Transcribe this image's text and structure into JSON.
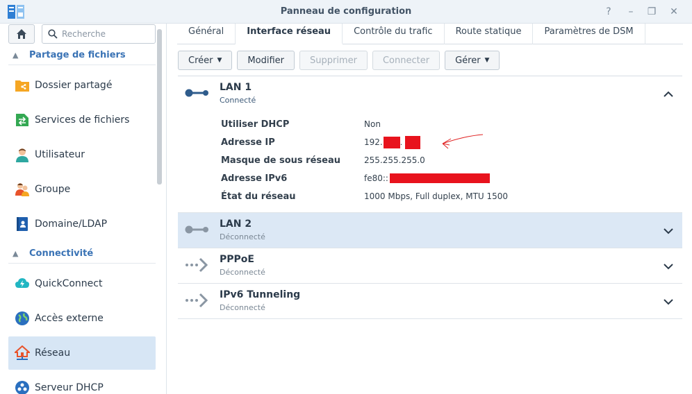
{
  "window": {
    "title": "Panneau de configuration",
    "help_glyph": "?",
    "minimize_glyph": "–",
    "maximize_glyph": "❐",
    "close_glyph": "✕"
  },
  "sidebar": {
    "search_placeholder": "Recherche",
    "sections": [
      {
        "label": "Partage de fichiers",
        "items": [
          {
            "label": "Dossier partagé",
            "icon": "shared-folder-icon"
          },
          {
            "label": "Services de fichiers",
            "icon": "file-services-icon"
          },
          {
            "label": "Utilisateur",
            "icon": "user-icon"
          },
          {
            "label": "Groupe",
            "icon": "group-icon"
          },
          {
            "label": "Domaine/LDAP",
            "icon": "domain-ldap-icon"
          }
        ]
      },
      {
        "label": "Connectivité",
        "items": [
          {
            "label": "QuickConnect",
            "icon": "quickconnect-icon"
          },
          {
            "label": "Accès externe",
            "icon": "external-access-icon"
          },
          {
            "label": "Réseau",
            "icon": "network-icon",
            "active": true
          },
          {
            "label": "Serveur DHCP",
            "icon": "dhcp-server-icon"
          }
        ]
      }
    ]
  },
  "tabs": [
    {
      "label": "Général"
    },
    {
      "label": "Interface réseau",
      "active": true
    },
    {
      "label": "Contrôle du trafic"
    },
    {
      "label": "Route statique"
    },
    {
      "label": "Paramètres de DSM"
    }
  ],
  "toolbar": {
    "create": "Créer",
    "modify": "Modifier",
    "delete": "Supprimer",
    "connect": "Connecter",
    "manage": "Gérer"
  },
  "interfaces": [
    {
      "name": "LAN 1",
      "status": "Connecté",
      "expanded": true,
      "details": {
        "dhcp_label": "Utiliser DHCP",
        "dhcp_value": "Non",
        "ip_label": "Adresse IP",
        "ip_value": "192.",
        "mask_label": "Masque de sous réseau",
        "mask_value": "255.255.255.0",
        "ipv6_label": "Adresse IPv6",
        "ipv6_value": "fe80::",
        "state_label": "État du réseau",
        "state_value": "1000 Mbps, Full duplex, MTU 1500"
      }
    },
    {
      "name": "LAN 2",
      "status": "Déconnecté"
    },
    {
      "name": "PPPoE",
      "status": "Déconnecté"
    },
    {
      "name": "IPv6 Tunneling",
      "status": "Déconnecté"
    }
  ],
  "colors": {
    "accent": "#3a73b5",
    "selected_bg": "#dce8f5",
    "redaction": "#e8131d"
  }
}
